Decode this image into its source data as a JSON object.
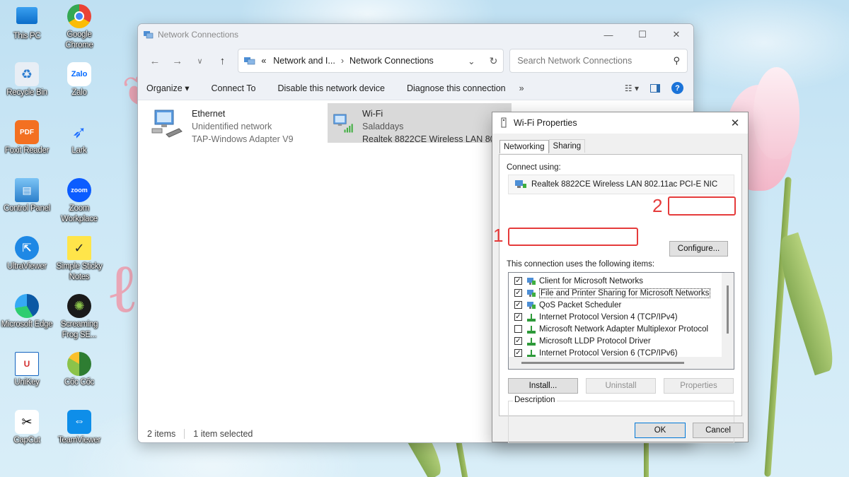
{
  "desktop_icons": [
    {
      "label": "This PC"
    },
    {
      "label": "Google Chrome"
    },
    {
      "label": "Recycle Bin"
    },
    {
      "label": "Zalo"
    },
    {
      "label": "Foxit Reader"
    },
    {
      "label": "Lark"
    },
    {
      "label": "Control Panel"
    },
    {
      "label": "Zoom Workplace"
    },
    {
      "label": "UltraViewer"
    },
    {
      "label": "Simple Sticky Notes"
    },
    {
      "label": "Microsoft Edge"
    },
    {
      "label": "Screaming Frog SE..."
    },
    {
      "label": "UniKey"
    },
    {
      "label": "Cốc Cốc"
    },
    {
      "label": "CapCut"
    },
    {
      "label": "TeamViewer"
    }
  ],
  "explorer": {
    "title": "Network Connections",
    "breadcrumb": {
      "prefix": "«",
      "parent": "Network and I...",
      "current": "Network Connections"
    },
    "search_placeholder": "Search Network Connections",
    "commands": [
      "Organize ▾",
      "Connect To",
      "Disable this network device",
      "Diagnose this connection"
    ],
    "more": "»",
    "connections": [
      {
        "name": "Ethernet",
        "status": "Unidentified network",
        "adapter": "TAP-Windows Adapter V9"
      },
      {
        "name": "Wi-Fi",
        "status": "Saladdays",
        "adapter": "Realtek 8822CE Wireless LAN 802..."
      }
    ],
    "status": {
      "count": "2 items",
      "selected": "1 item selected"
    }
  },
  "dialog": {
    "title": "Wi-Fi Properties",
    "tabs": [
      "Networking",
      "Sharing"
    ],
    "connect_using_label": "Connect using:",
    "adapter": "Realtek 8822CE Wireless LAN 802.11ac PCI-E NIC",
    "configure_label": "Configure...",
    "items_label": "This connection uses the following items:",
    "items": [
      {
        "label": "Client for Microsoft Networks",
        "checked": true
      },
      {
        "label": "File and Printer Sharing for Microsoft Networks",
        "checked": true
      },
      {
        "label": "QoS Packet Scheduler",
        "checked": true
      },
      {
        "label": "Internet Protocol Version 4 (TCP/IPv4)",
        "checked": true
      },
      {
        "label": "Microsoft Network Adapter Multiplexor Protocol",
        "checked": false
      },
      {
        "label": "Microsoft LLDP Protocol Driver",
        "checked": true
      },
      {
        "label": "Internet Protocol Version 6 (TCP/IPv6)",
        "checked": true
      }
    ],
    "install_label": "Install...",
    "uninstall_label": "Uninstall",
    "properties_label": "Properties",
    "description_label": "Description",
    "ok_label": "OK",
    "cancel_label": "Cancel"
  },
  "annotations": {
    "step1": "1",
    "step2": "2",
    "color": "#e53b3b"
  }
}
